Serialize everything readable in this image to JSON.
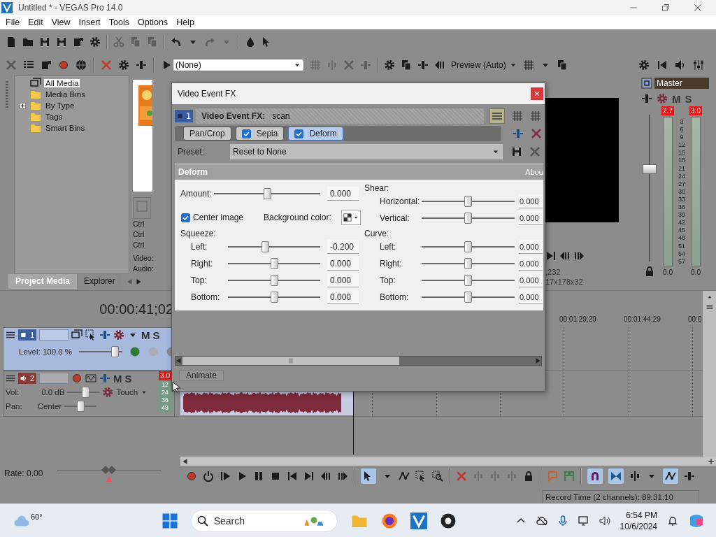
{
  "window": {
    "title": "Untitled * - VEGAS Pro 14.0"
  },
  "menu": [
    "File",
    "Edit",
    "View",
    "Insert",
    "Tools",
    "Options",
    "Help"
  ],
  "project_media": {
    "tree": [
      {
        "label": "All Media",
        "kind": "all",
        "selected": true,
        "expandable": false
      },
      {
        "label": "Media Bins",
        "kind": "folder",
        "selected": false,
        "expandable": false
      },
      {
        "label": "By Type",
        "kind": "folder",
        "selected": false,
        "expandable": true
      },
      {
        "label": "Tags",
        "kind": "folder",
        "selected": false,
        "expandable": false
      },
      {
        "label": "Smart Bins",
        "kind": "folder",
        "selected": false,
        "expandable": false
      }
    ],
    "shortcuts": [
      "Ctrl",
      "Ctrl",
      "Ctrl"
    ],
    "info": [
      "Video:",
      "Audio:"
    ],
    "tabs": [
      {
        "label": "Project Media",
        "selected": true
      },
      {
        "label": "Explorer",
        "selected": false
      }
    ]
  },
  "trimmer": {
    "source": "(None)"
  },
  "preview": {
    "quality": "Preview (Auto)",
    "info": [
      ",232",
      "17x178x32"
    ]
  },
  "master": {
    "title": "Master",
    "mute": "M",
    "solo": "S",
    "peaks": [
      "2.7",
      "3.0"
    ],
    "scale": [
      "3",
      "6",
      "9",
      "12",
      "15",
      "18",
      "21",
      "24",
      "27",
      "30",
      "33",
      "36",
      "39",
      "42",
      "45",
      "48",
      "51",
      "54",
      "57"
    ],
    "readings": [
      "0.0",
      "0.0"
    ],
    "fader": {
      "level": 0.64
    }
  },
  "timeline": {
    "time": "00:00:41;02",
    "ruler": [
      "00:01:29;29",
      "00:01:44;29",
      "00:0"
    ],
    "tracks": [
      {
        "kind": "video",
        "number": "1",
        "selected": true,
        "mute": "M",
        "solo": "S",
        "opacity": {
          "label": "Level: 100.0 %",
          "level": 0.9
        }
      },
      {
        "kind": "audio",
        "number": "2",
        "selected": false,
        "mute": "M",
        "solo": "S",
        "peak": "3.0",
        "meter_scale": [
          "12",
          "24",
          "36",
          "48"
        ],
        "volume": {
          "label": "Vol:",
          "reading": "0.0 dB",
          "level": 0.6
        },
        "automation": "Touch",
        "pan": {
          "label": "Pan:",
          "reading": "Center",
          "level": 0.5
        }
      }
    ],
    "rate": {
      "label": "Rate: 0.00",
      "level": 0.5
    }
  },
  "status_bar": {
    "record_time": "Record Time (2 channels): 89:31:10"
  },
  "dialog": {
    "title": "Video Event FX",
    "track_number": "1",
    "header_label": "Video Event FX:",
    "event_name": "scan",
    "chain": [
      {
        "label": "Pan/Crop",
        "kind": "builtin",
        "selected": false
      },
      {
        "label": "Sepia",
        "kind": "plugin",
        "checked": true,
        "selected": false
      },
      {
        "label": "Deform",
        "kind": "plugin",
        "checked": true,
        "selected": true
      }
    ],
    "preset_label": "Preset:",
    "preset": "Reset to None",
    "section": "Deform",
    "about": "Abou",
    "amount": {
      "label": "Amount:",
      "level": 0.5,
      "value": "0.000"
    },
    "center_image": {
      "label": "Center image",
      "checked": true
    },
    "background_color_label": "Background color:",
    "squeeze": {
      "title": "Squeeze:",
      "rows": [
        {
          "label": "Left:",
          "level": 0.4,
          "value": "-0.200"
        },
        {
          "label": "Right:",
          "level": 0.5,
          "value": "0.000"
        },
        {
          "label": "Top:",
          "level": 0.5,
          "value": "0.000"
        },
        {
          "label": "Bottom:",
          "level": 0.5,
          "value": "0.000"
        }
      ]
    },
    "shear": {
      "title": "Shear:",
      "rows": [
        {
          "label": "Horizontal:",
          "level": 0.5,
          "value": "0.000"
        },
        {
          "label": "Vertical:",
          "level": 0.5,
          "value": "0.000"
        }
      ]
    },
    "curve": {
      "title": "Curve:",
      "rows": [
        {
          "label": "Left:",
          "level": 0.5,
          "value": "0.000"
        },
        {
          "label": "Right:",
          "level": 0.5,
          "value": "0.000"
        },
        {
          "label": "Top:",
          "level": 0.5,
          "value": "0.000"
        },
        {
          "label": "Bottom:",
          "level": 0.5,
          "value": "0.000"
        }
      ]
    },
    "animate": "Animate"
  },
  "taskbar": {
    "weather": "60°",
    "search": {
      "placeholder": "Search"
    },
    "time": "6:54 PM",
    "date": "10/6/2024"
  }
}
